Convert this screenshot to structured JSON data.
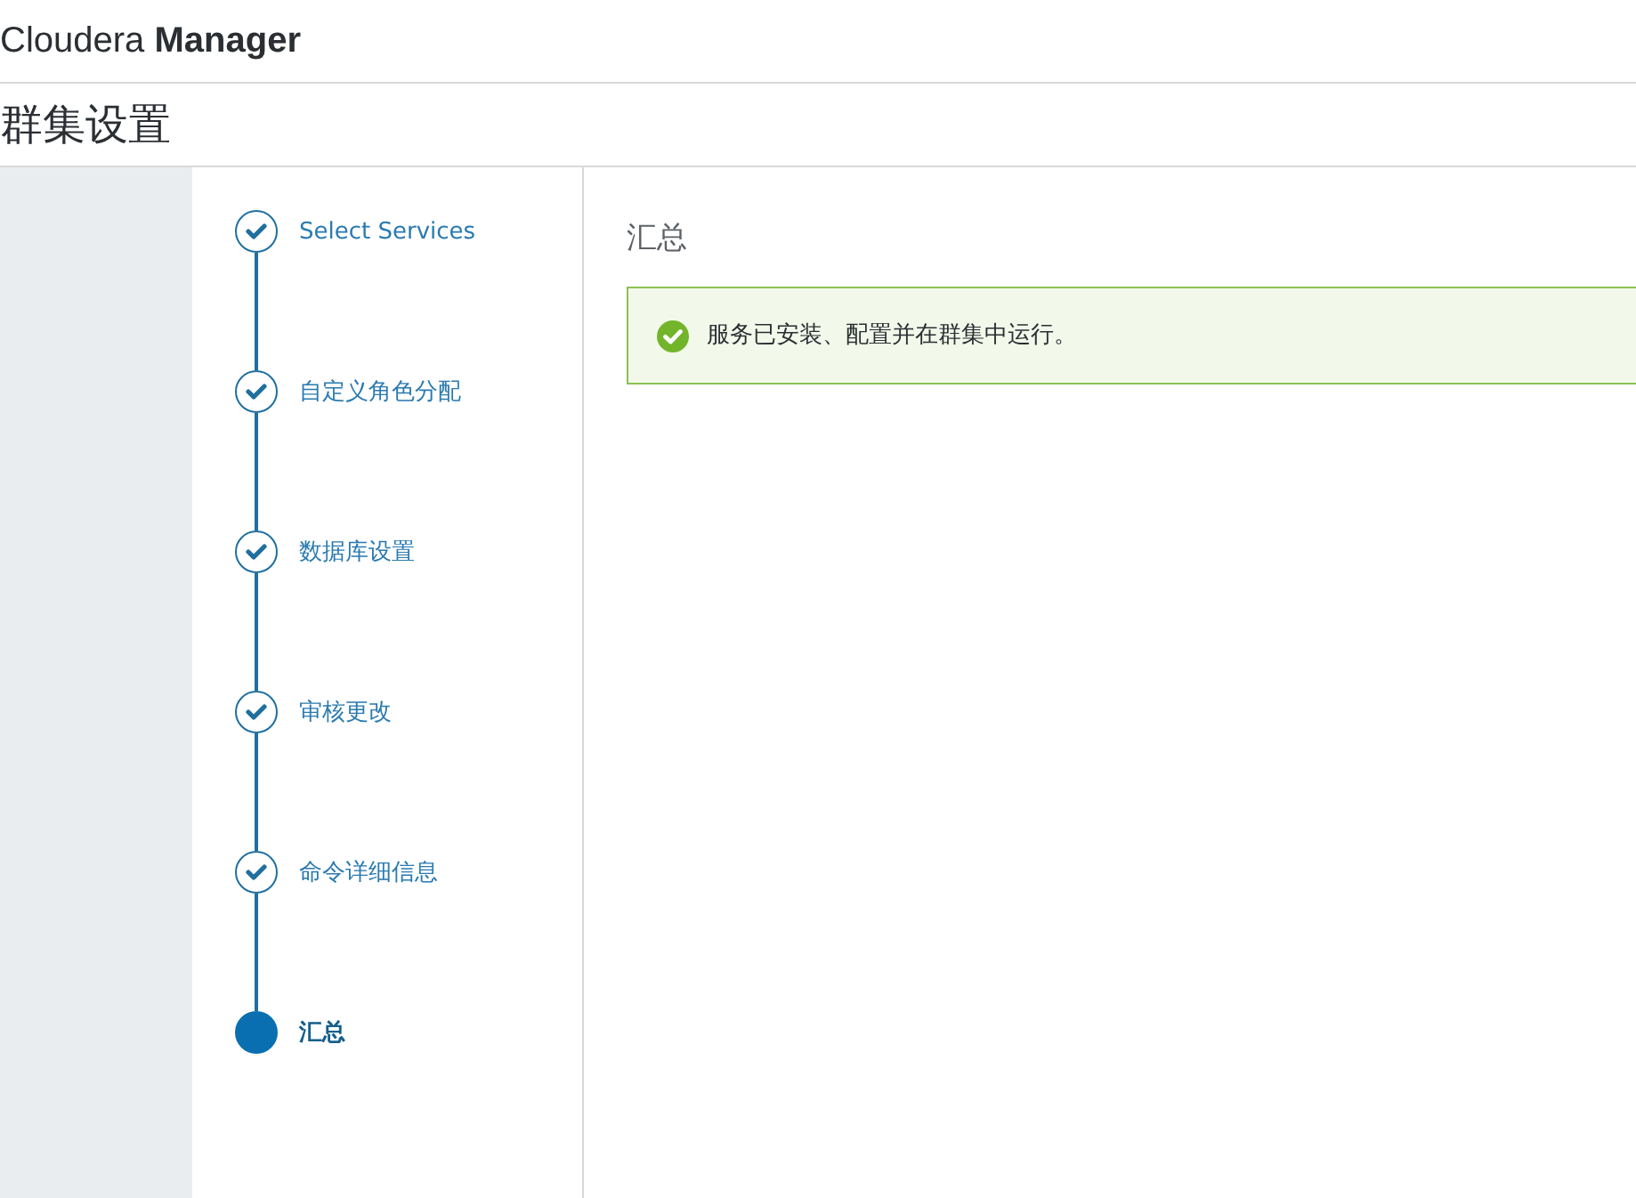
{
  "brand": {
    "light": "Cloudera",
    "bold": "Manager"
  },
  "page_title": "群集设置",
  "steps": [
    {
      "label": "Select Services",
      "selected": false
    },
    {
      "label": "自定义角色分配",
      "selected": false
    },
    {
      "label": "数据库设置",
      "selected": false
    },
    {
      "label": "审核更改",
      "selected": false
    },
    {
      "label": "命令详细信息",
      "selected": false
    },
    {
      "label": "汇总",
      "selected": true
    }
  ],
  "content": {
    "heading": "汇总",
    "alert": {
      "kind": "success",
      "text": "服务已安装、配置并在群集中运行。"
    }
  }
}
